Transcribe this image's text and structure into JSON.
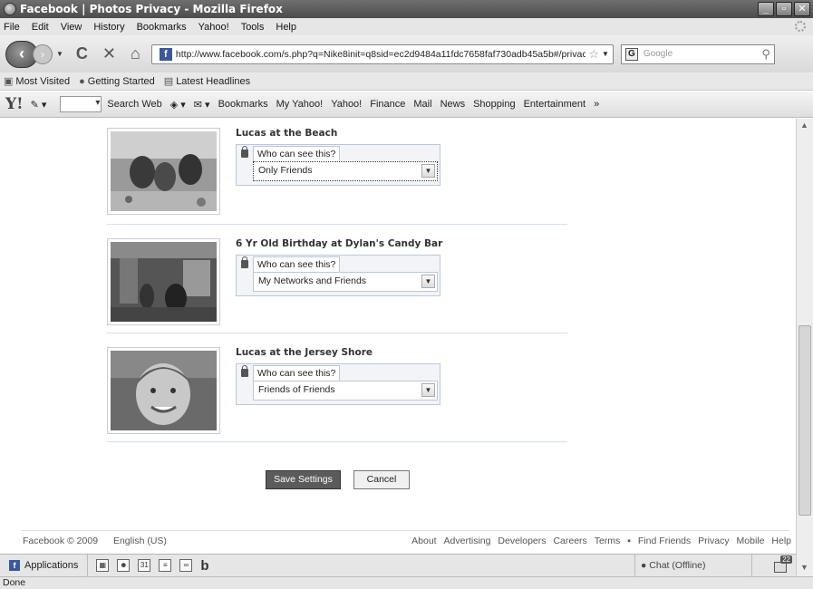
{
  "window": {
    "title": "Facebook | Photos Privacy - Mozilla Firefox",
    "buttons": [
      "_",
      "▫",
      "✕"
    ]
  },
  "menu": [
    "File",
    "Edit",
    "View",
    "History",
    "Bookmarks",
    "Yahoo!",
    "Tools",
    "Help"
  ],
  "nav": {
    "url": "http://www.facebook.com/s.php?q=Nike8init=q8sid=ec2d9484a11fdc7658faf730adb45a5b#/privacy/?view=pt",
    "search_placeholder": "Google"
  },
  "bookmarks": [
    "Most Visited",
    "Getting Started",
    "Latest Headlines"
  ],
  "yahoo_toolbar": {
    "logo": "Y!",
    "items": [
      "Search Web",
      "Bookmarks",
      "My Yahoo!",
      "Yahoo!",
      "Finance",
      "Mail",
      "News",
      "Shopping",
      "Entertainment"
    ],
    "more": "»"
  },
  "photos": [
    {
      "title": "Lucas at the Beach",
      "who_label": "Who can see this?",
      "selected": "Only Friends"
    },
    {
      "title": "6 Yr Old Birthday at Dylan's Candy Bar",
      "who_label": "Who can see this?",
      "selected": "My Networks and Friends"
    },
    {
      "title": "Lucas at the Jersey Shore",
      "who_label": "Who can see this?",
      "selected": "Friends of Friends"
    }
  ],
  "actions": {
    "save": "Save Settings",
    "cancel": "Cancel"
  },
  "footer": {
    "copyright": "Facebook © 2009",
    "language": "English (US)",
    "links": [
      "About",
      "Advertising",
      "Developers",
      "Careers",
      "Terms",
      "▪",
      "Find Friends",
      "Privacy",
      "Mobile",
      "Help"
    ]
  },
  "appbar": {
    "applications": "Applications",
    "chat": "Chat (Offline)",
    "notifications": "22"
  },
  "status": "Done"
}
